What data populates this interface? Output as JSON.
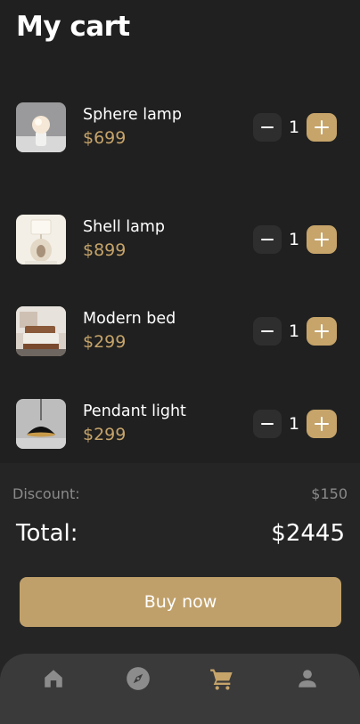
{
  "header": {
    "title": "My cart"
  },
  "cart": {
    "items": [
      {
        "name": "Sphere lamp",
        "price": "$699",
        "quantity": "1",
        "image": "sphere-lamp-image"
      },
      {
        "name": "Shell lamp",
        "price": "$899",
        "quantity": "1",
        "image": "shell-lamp-image"
      },
      {
        "name": "Modern bed",
        "price": "$299",
        "quantity": "1",
        "image": "modern-bed-image"
      },
      {
        "name": "Pendant light",
        "price": "$299",
        "quantity": "1",
        "image": "pendant-light-image"
      }
    ]
  },
  "summary": {
    "discount_label": "Discount:",
    "discount_value": "$150",
    "total_label": "Total:",
    "total_value": "$2445",
    "buy_label": "Buy now"
  },
  "nav": {
    "items": [
      {
        "icon": "home-icon",
        "active": false
      },
      {
        "icon": "compass-icon",
        "active": false
      },
      {
        "icon": "cart-icon",
        "active": true
      },
      {
        "icon": "person-icon",
        "active": false
      }
    ]
  },
  "colors": {
    "background": "#202020",
    "accent": "#c6a46a",
    "nav_background": "#3a3a3a",
    "inactive_icon": "#8c8c8c"
  }
}
